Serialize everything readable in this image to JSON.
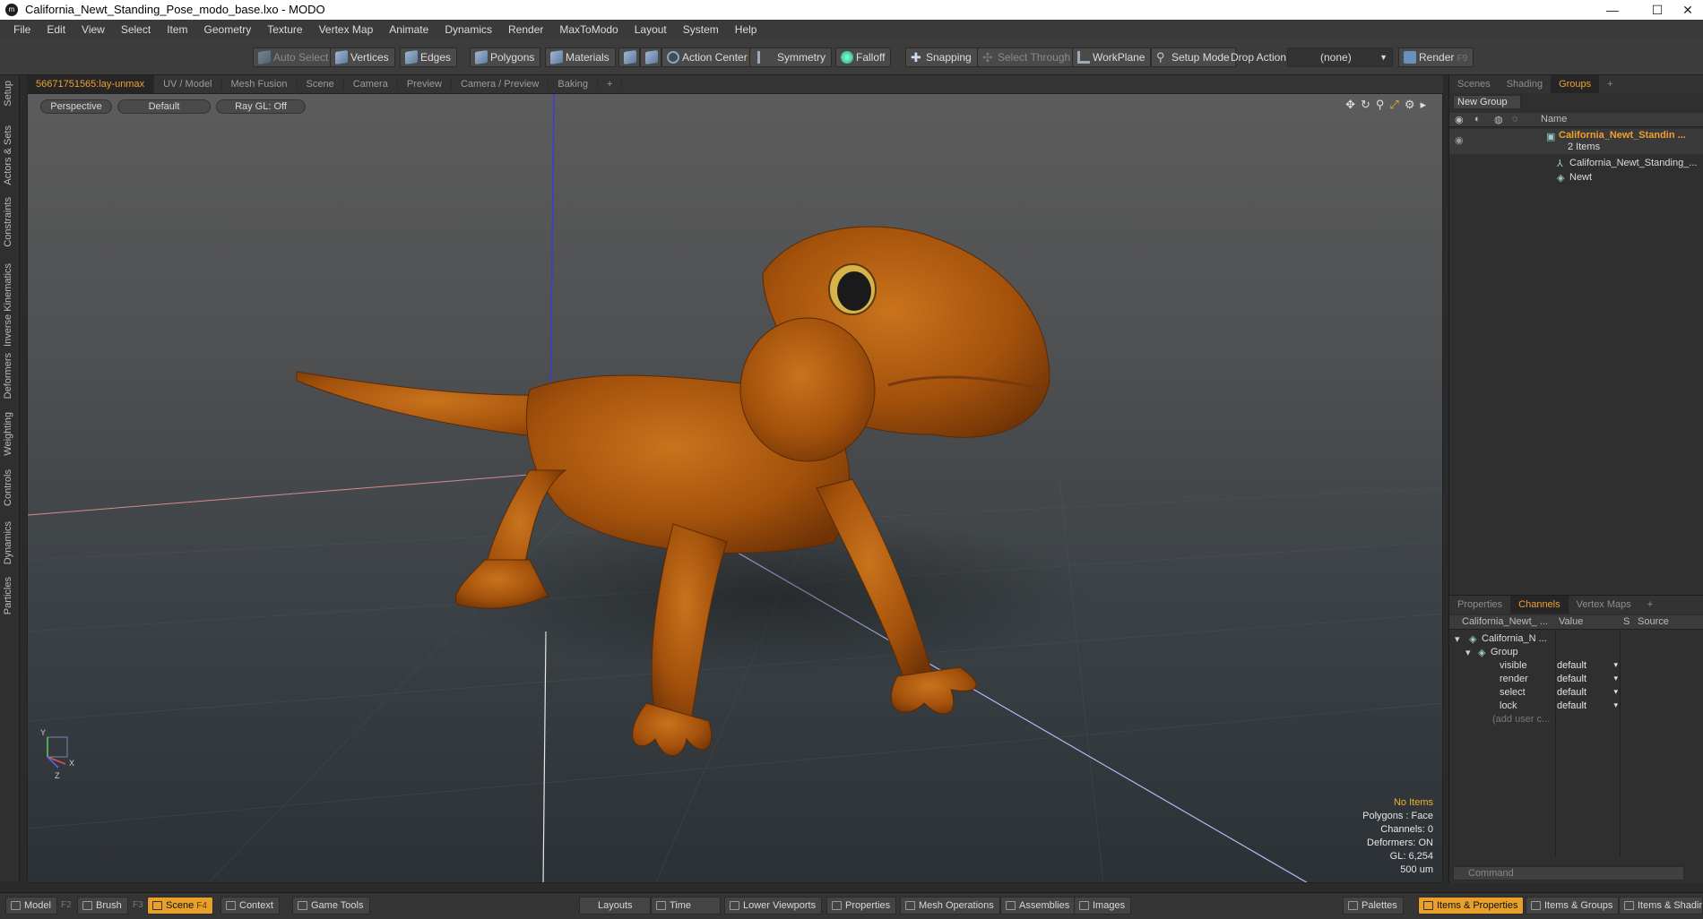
{
  "window": {
    "title": "California_Newt_Standing_Pose_modo_base.lxo - MODO",
    "logo": "m",
    "controls": [
      "—",
      "☐",
      "✕"
    ]
  },
  "menu": [
    "File",
    "Edit",
    "View",
    "Select",
    "Item",
    "Geometry",
    "Texture",
    "Vertex Map",
    "Animate",
    "Dynamics",
    "Render",
    "MaxToModo",
    "Layout",
    "System",
    "Help"
  ],
  "toolbar": {
    "auto_select": "Auto Select",
    "vertices": "Vertices",
    "edges": "Edges",
    "polygons": "Polygons",
    "materials": "Materials",
    "action_center": "Action Center",
    "symmetry": "Symmetry",
    "falloff": "Falloff",
    "snapping": "Snapping",
    "select_through": "Select Through",
    "workplane": "WorkPlane",
    "setup_mode": "Setup Mode",
    "drop_action": "Drop Action",
    "drop_value": "(none)",
    "render": "Render",
    "render_key": "F9"
  },
  "left_tabs": [
    "Setup",
    "Actors & Sets",
    "Constraints",
    "Inverse Kinematics",
    "Deformers",
    "Weighting",
    "Controls",
    "Dynamics",
    "Particles"
  ],
  "viewport_tabs": [
    "56671751565:lay-unmax",
    "UV / Model",
    "Mesh Fusion",
    "Scene",
    "Camera",
    "Preview",
    "Camera / Preview",
    "Baking",
    "+"
  ],
  "viewport": {
    "perspective": "Perspective",
    "shading": "Default",
    "raygl": "Ray GL: Off",
    "axis_y": "Y",
    "axis_x": "X",
    "axis_z": "Z"
  },
  "hud": {
    "items": "No Items",
    "polygons": "Polygons : Face",
    "channels": "Channels: 0",
    "deformers": "Deformers: ON",
    "gl": "GL: 6,254",
    "scale": "500 um"
  },
  "colors": {
    "accent": "#f0a030",
    "model": "#b8610f"
  },
  "groups_panel": {
    "tabs": [
      "Scenes",
      "Shading",
      "Groups",
      "+"
    ],
    "new_group": "New Group",
    "col_name": "Name",
    "group_name": "California_Newt_Standin ...",
    "group_count": "2 Items",
    "children": [
      "California_Newt_Standing_...",
      "Newt"
    ]
  },
  "channels_panel": {
    "tabs": [
      "Properties",
      "Channels",
      "Vertex Maps",
      "+"
    ],
    "col_item": "California_Newt_ ...",
    "col_value": "Value",
    "col_s": "S",
    "col_source": "Source",
    "root": "California_N ...",
    "group": "Group",
    "rows": [
      {
        "name": "visible",
        "value": "default"
      },
      {
        "name": "render",
        "value": "default"
      },
      {
        "name": "select",
        "value": "default"
      },
      {
        "name": "lock",
        "value": "default"
      }
    ],
    "add_user": "(add user c...",
    "command_placeholder": "Command"
  },
  "bottombar": {
    "model": "Model",
    "model_key": "F2",
    "brush": "Brush",
    "brush_key": "F3",
    "scene": "Scene",
    "scene_key": "F4",
    "context": "Context",
    "game_tools": "Game Tools",
    "layouts": "Layouts",
    "time": "Time",
    "lower_viewports": "Lower Viewports",
    "properties": "Properties",
    "mesh_ops": "Mesh Operations",
    "assemblies": "Assemblies",
    "images": "Images",
    "palettes": "Palettes",
    "items_props": "Items & Properties",
    "items_groups": "Items & Groups",
    "items_shading": "Items & Shadin"
  }
}
